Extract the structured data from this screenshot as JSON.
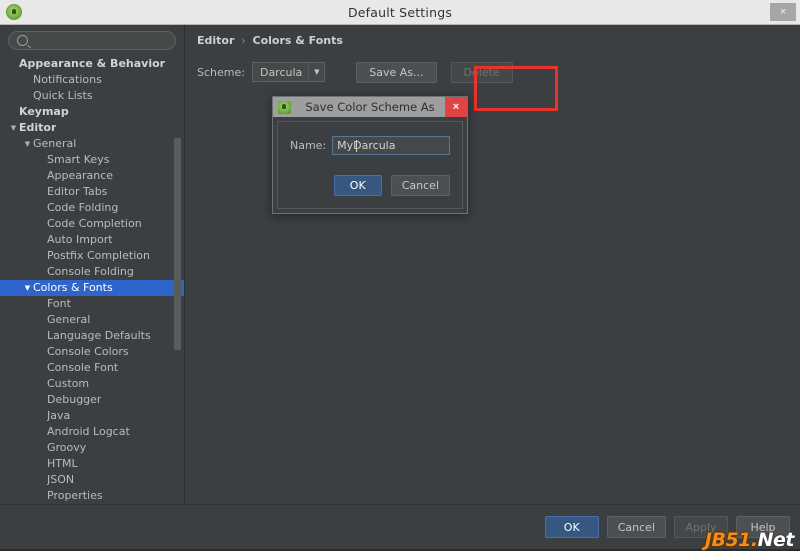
{
  "window": {
    "title": "Default Settings",
    "app_icon": "android-studio-icon",
    "close_label": "×"
  },
  "sidebar": {
    "search": {
      "value": "",
      "placeholder": "",
      "icon": "search-icon"
    },
    "items": [
      {
        "label": "Appearance & Behavior",
        "indent": 0,
        "bold": true,
        "twisty": "",
        "selected": false
      },
      {
        "label": "Notifications",
        "indent": 1,
        "bold": false,
        "twisty": "",
        "selected": false
      },
      {
        "label": "Quick Lists",
        "indent": 1,
        "bold": false,
        "twisty": "",
        "selected": false
      },
      {
        "label": "Keymap",
        "indent": 0,
        "bold": true,
        "twisty": "",
        "selected": false
      },
      {
        "label": "Editor",
        "indent": 0,
        "bold": true,
        "twisty": "▼",
        "selected": false
      },
      {
        "label": "General",
        "indent": 1,
        "bold": false,
        "twisty": "▼",
        "selected": false
      },
      {
        "label": "Smart Keys",
        "indent": 2,
        "bold": false,
        "twisty": "",
        "selected": false
      },
      {
        "label": "Appearance",
        "indent": 2,
        "bold": false,
        "twisty": "",
        "selected": false
      },
      {
        "label": "Editor Tabs",
        "indent": 2,
        "bold": false,
        "twisty": "",
        "selected": false
      },
      {
        "label": "Code Folding",
        "indent": 2,
        "bold": false,
        "twisty": "",
        "selected": false
      },
      {
        "label": "Code Completion",
        "indent": 2,
        "bold": false,
        "twisty": "",
        "selected": false
      },
      {
        "label": "Auto Import",
        "indent": 2,
        "bold": false,
        "twisty": "",
        "selected": false
      },
      {
        "label": "Postfix Completion",
        "indent": 2,
        "bold": false,
        "twisty": "",
        "selected": false
      },
      {
        "label": "Console Folding",
        "indent": 2,
        "bold": false,
        "twisty": "",
        "selected": false
      },
      {
        "label": "Colors & Fonts",
        "indent": 1,
        "bold": false,
        "twisty": "▼",
        "selected": true
      },
      {
        "label": "Font",
        "indent": 2,
        "bold": false,
        "twisty": "",
        "selected": false
      },
      {
        "label": "General",
        "indent": 2,
        "bold": false,
        "twisty": "",
        "selected": false
      },
      {
        "label": "Language Defaults",
        "indent": 2,
        "bold": false,
        "twisty": "",
        "selected": false
      },
      {
        "label": "Console Colors",
        "indent": 2,
        "bold": false,
        "twisty": "",
        "selected": false
      },
      {
        "label": "Console Font",
        "indent": 2,
        "bold": false,
        "twisty": "",
        "selected": false
      },
      {
        "label": "Custom",
        "indent": 2,
        "bold": false,
        "twisty": "",
        "selected": false
      },
      {
        "label": "Debugger",
        "indent": 2,
        "bold": false,
        "twisty": "",
        "selected": false
      },
      {
        "label": "Java",
        "indent": 2,
        "bold": false,
        "twisty": "",
        "selected": false
      },
      {
        "label": "Android Logcat",
        "indent": 2,
        "bold": false,
        "twisty": "",
        "selected": false
      },
      {
        "label": "Groovy",
        "indent": 2,
        "bold": false,
        "twisty": "",
        "selected": false
      },
      {
        "label": "HTML",
        "indent": 2,
        "bold": false,
        "twisty": "",
        "selected": false
      },
      {
        "label": "JSON",
        "indent": 2,
        "bold": false,
        "twisty": "",
        "selected": false
      },
      {
        "label": "Properties",
        "indent": 2,
        "bold": false,
        "twisty": "",
        "selected": false
      }
    ]
  },
  "content": {
    "breadcrumb": {
      "root": "Editor",
      "separator": "›",
      "leaf": "Colors & Fonts"
    },
    "scheme": {
      "label": "Scheme:",
      "value": "Darcula",
      "arrow": "▼",
      "save_as_label": "Save As...",
      "delete_label": "Delete",
      "highlight_color": "#e8322a"
    }
  },
  "dialog": {
    "title": "Save Color Scheme As",
    "app_icon": "android-studio-icon",
    "close_label": "×",
    "name_label": "Name:",
    "name_value": "MyDarcula",
    "ok_label": "OK",
    "cancel_label": "Cancel"
  },
  "footer": {
    "ok_label": "OK",
    "cancel_label": "Cancel",
    "apply_label": "Apply",
    "help_label": "Help"
  },
  "watermark": {
    "brand": "JB51.",
    "suffix": "Net"
  }
}
